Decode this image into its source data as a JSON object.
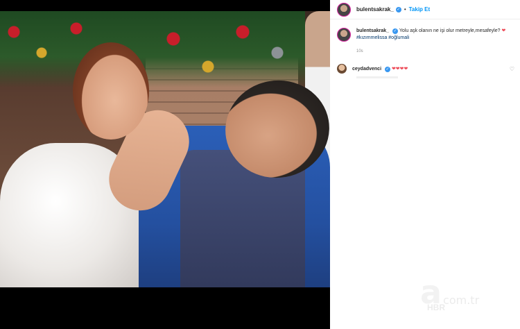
{
  "post": {
    "username": "bulentsakrak_",
    "follow_label": "Takip Et",
    "separator": "•",
    "caption_text": "Yolu aşk olanın ne işi olur metreyle,mesafeyle?",
    "caption_heart": "❤",
    "hashtags": "#kızımmelissa #oğlumali",
    "time": "10s"
  },
  "comment": {
    "username": "ceydadvenci",
    "text": "❤❤❤❤",
    "like_icon": "♡"
  },
  "watermark": {
    "logo": "a",
    "domain": "com.tr",
    "brand": "HBR"
  },
  "colors": {
    "verified": "#3897f0",
    "follow": "#0095f6",
    "heart": "#ed4956"
  }
}
